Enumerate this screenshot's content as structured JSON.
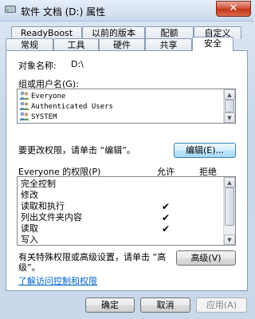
{
  "window": {
    "title": "软件 文档 (D:) 属性",
    "close_label": "✕"
  },
  "tabs_row1": [
    {
      "label": "ReadyBoost"
    },
    {
      "label": "以前的版本"
    },
    {
      "label": "配额"
    },
    {
      "label": "自定义"
    }
  ],
  "tabs_row2": [
    {
      "label": "常规"
    },
    {
      "label": "工具"
    },
    {
      "label": "硬件"
    },
    {
      "label": "共享"
    },
    {
      "label": "安全",
      "active": true
    }
  ],
  "security": {
    "object_name_label": "对象名称:",
    "object_name_value": "D:\\",
    "groups_label": "组或用户名(G):",
    "users": [
      {
        "name": "Everyone"
      },
      {
        "name": "Authenticated Users"
      },
      {
        "name": "SYSTEM"
      }
    ],
    "change_hint": "要更改权限，请单击 “编辑”。",
    "edit_button": "编辑(E)...",
    "permissions_title": "Everyone 的权限(P)",
    "allow_header": "允许",
    "deny_header": "拒绝",
    "permissions": [
      {
        "name": "完全控制",
        "allow": false,
        "deny": false
      },
      {
        "name": "修改",
        "allow": false,
        "deny": false
      },
      {
        "name": "读取和执行",
        "allow": true,
        "deny": false
      },
      {
        "name": "列出文件夹内容",
        "allow": true,
        "deny": false
      },
      {
        "name": "读取",
        "allow": true,
        "deny": false
      },
      {
        "name": "写入",
        "allow": false,
        "deny": false
      }
    ],
    "check_glyph": "✔",
    "special_hint_line1": "有关特殊权限或高级设置，请单击 “高",
    "special_hint_line2": "级”。",
    "advanced_button": "高级(V)",
    "learn_link": "了解访问控制和权限"
  },
  "footer": {
    "ok": "确定",
    "cancel": "取消",
    "apply": "应用(A)"
  }
}
